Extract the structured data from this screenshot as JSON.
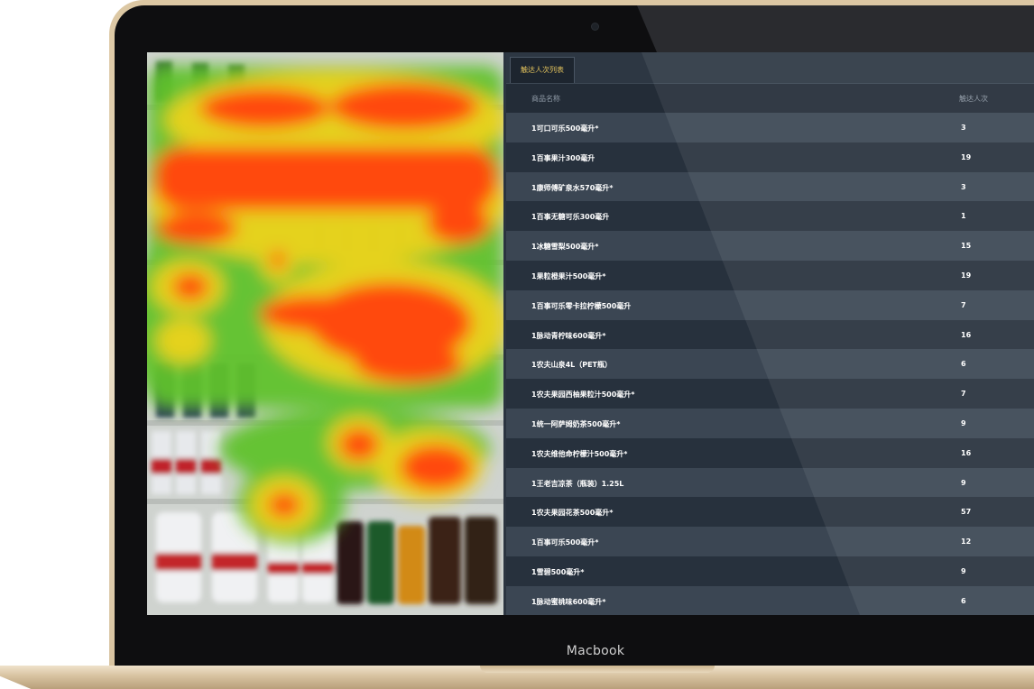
{
  "device": {
    "brand_label": "Macbook"
  },
  "panel": {
    "tab_label": "触达人次列表",
    "columns": {
      "name": "商品名称",
      "count": "触达人次"
    },
    "rows": [
      {
        "name": "1可口可乐500毫升*",
        "count": "3"
      },
      {
        "name": "1百事果汁300毫升",
        "count": "19"
      },
      {
        "name": "1康师傅矿泉水570毫升*",
        "count": "3"
      },
      {
        "name": "1百事无糖可乐300毫升",
        "count": "1"
      },
      {
        "name": "1冰糖雪梨500毫升*",
        "count": "15"
      },
      {
        "name": "1果粒橙果汁500毫升*",
        "count": "19"
      },
      {
        "name": "1百事可乐零卡拉柠檬500毫升",
        "count": "7"
      },
      {
        "name": "1脉动青柠味600毫升*",
        "count": "16"
      },
      {
        "name": "1农夫山泉4L（PET瓶）",
        "count": "6"
      },
      {
        "name": "1农夫果园西柚果粒汁500毫升*",
        "count": "7"
      },
      {
        "name": "1统一阿萨姆奶茶500毫升*",
        "count": "9"
      },
      {
        "name": "1农夫维他命柠檬汁500毫升*",
        "count": "16"
      },
      {
        "name": "1王老吉凉茶（瓶装）1.25L",
        "count": "9"
      },
      {
        "name": "1农夫果园花茶500毫升*",
        "count": "57"
      },
      {
        "name": "1百事可乐500毫升*",
        "count": "12"
      },
      {
        "name": "1雪碧500毫升*",
        "count": "9"
      },
      {
        "name": "1脉动蜜桃味600毫升*",
        "count": "6"
      }
    ]
  },
  "colors": {
    "heat_hot": "#ff4a0a",
    "heat_warm": "#f2c20c",
    "heat_cool": "#62c52e",
    "tab_text": "#e2c25c",
    "row_odd": "#3b4653",
    "row_even": "#27313d"
  }
}
